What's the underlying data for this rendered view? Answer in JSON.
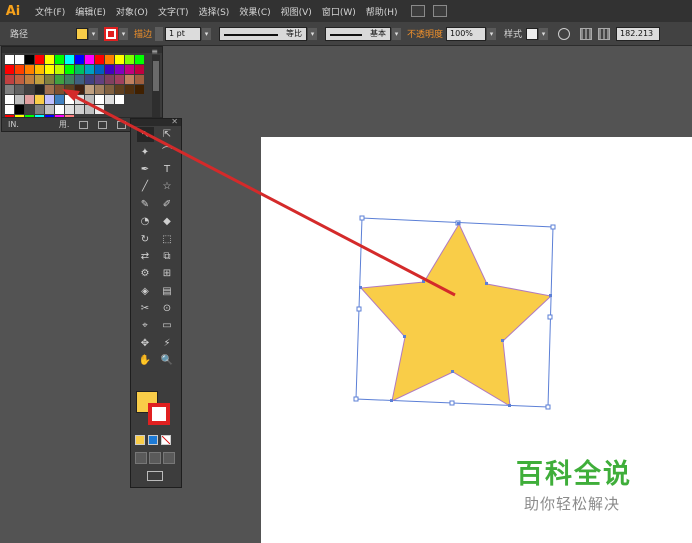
{
  "app": {
    "logo": "Ai"
  },
  "menu": [
    "文件(F)",
    "编辑(E)",
    "对象(O)",
    "文字(T)",
    "选择(S)",
    "效果(C)",
    "视图(V)",
    "窗口(W)",
    "帮助(H)"
  ],
  "control_bar": {
    "selection_label": "路径",
    "fill_color": "#f9cd48",
    "stroke_color": "#e02020",
    "stroke_label": "描边",
    "stroke_weight": "1 pt",
    "profile_label": "等比",
    "brush_label": "基本",
    "opacity_label": "不透明度",
    "opacity_value": "100%",
    "style_label": "样式",
    "width_value": "182.213"
  },
  "swatches_panel": {
    "footer_left": "IN.",
    "footer_mid": "用.",
    "rows": [
      [
        "#ffffff",
        "#ffffff",
        "#000000",
        "#ff0000",
        "#ffff00",
        "#00ff00",
        "#00ffff",
        "#0000ff",
        "#ff00ff",
        "#ff0000",
        "#ff7f00",
        "#ffff00",
        "#7fff00",
        "#00ff00"
      ],
      [
        "#ff0000",
        "#ff4000",
        "#ff8000",
        "#ffbf00",
        "#ffff00",
        "#c0ff00",
        "#00ff00",
        "#00c060",
        "#00a0c0",
        "#0060c0",
        "#4000c0",
        "#8000c0",
        "#c00080",
        "#c00040"
      ],
      [
        "#c04040",
        "#c06040",
        "#c08040",
        "#c0a040",
        "#808040",
        "#40a040",
        "#408060",
        "#406080",
        "#404080",
        "#604080",
        "#804060",
        "#a04060",
        "#c08060",
        "#a06040"
      ],
      [
        "#808080",
        "#606060",
        "#404040",
        "#202020",
        "#a07050",
        "#805030",
        "#604020",
        "#402010",
        "#c0a080",
        "#a08060",
        "#806040",
        "#604020",
        "#503010",
        "#402000"
      ],
      [
        "#ffffff",
        "#c0c0c0",
        "#e0a0a0",
        "#f9cd48",
        "#c0c0ff",
        "#4080c0",
        "#ffffff",
        "#dddddd",
        "#bbbbbb",
        "#ffffff",
        "#dddddd",
        "#ffffff"
      ],
      [
        "#ffffff",
        "#000000",
        "#404040",
        "#808080",
        "#c0c0c0",
        "#ffffff",
        "#e0e0e0",
        "#d0d0d0",
        "#c0c0c0",
        "#eeeeee"
      ],
      [
        "#ff0000",
        "#ffff00",
        "#00ff00",
        "#00ffff",
        "#0000ff",
        "#ff00ff",
        "#ff8080"
      ]
    ]
  },
  "tools": {
    "rows": [
      [
        "↖",
        "⇱"
      ],
      [
        "✦",
        "⌒"
      ],
      [
        "✒",
        "T"
      ],
      [
        "╱",
        "☆"
      ],
      [
        "✎",
        "✐"
      ],
      [
        "◔",
        "◆"
      ],
      [
        "↻",
        "⬚"
      ],
      [
        "⇄",
        "⧉"
      ],
      [
        "⚙",
        "⊞"
      ],
      [
        "◈",
        "▤"
      ],
      [
        "✂",
        "⊙"
      ],
      [
        "⌖",
        "▭"
      ],
      [
        "✥",
        "⚡"
      ],
      [
        "✋",
        "🔍"
      ]
    ],
    "fill_color": "#f9cd48",
    "stroke_color": "#e02020"
  },
  "canvas": {
    "star_fill": "#f9cd48",
    "star_stroke": "#b07ac0",
    "arrow_color": "#d42a2a"
  },
  "watermark": {
    "title": "百科全说",
    "subtitle": "助你轻松解决"
  }
}
